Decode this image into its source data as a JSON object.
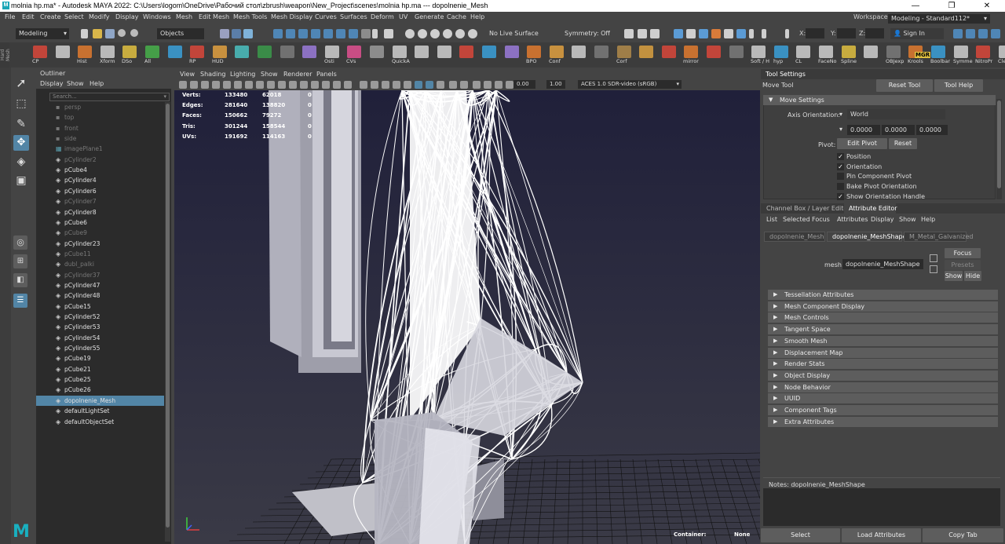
{
  "window": {
    "title": "molnia hp.ma* - Autodesk MAYA 2022: C:\\Users\\logom\\OneDrive\\Рабочий стол\\zbrush\\weapon\\New_Project\\scenes\\molnia hp.ma  ---  dopolnenie_Mesh",
    "app_icon_letter": "M",
    "controls": [
      "—",
      "❐",
      "✕"
    ]
  },
  "menubar": {
    "items": [
      "File",
      "Edit",
      "Create",
      "Select",
      "Modify",
      "Display",
      "Windows",
      "Mesh",
      "Edit Mesh",
      "Mesh Tools",
      "Mesh Display",
      "Curves",
      "Surfaces",
      "Deform",
      "UV",
      "Generate",
      "Cache",
      "Help"
    ],
    "workspace_label": "Workspace :",
    "workspace_value": "Modeling - Standard112*"
  },
  "statusline": {
    "menuset": "Modeling",
    "select_mode": "Objects",
    "live_surface": "No Live Surface",
    "symmetry": "Symmetry: Off",
    "x_label": "X:",
    "y_label": "Y:",
    "z_label": "Z:",
    "signin": "Sign In"
  },
  "shelf": {
    "side_label": "Hard Mesh",
    "items": [
      "CP",
      "",
      "Hist",
      "Xform",
      "DSo",
      "All",
      "",
      "RP",
      "HUD",
      "",
      "",
      "",
      "",
      "Osti",
      "CVs",
      "",
      "QuickA",
      "",
      "",
      "",
      "",
      "",
      "BPO",
      "Conf",
      "",
      "",
      "Corf",
      "",
      "",
      "mirror",
      "",
      "",
      "Soft / H",
      "hyp",
      "CL",
      "FaceNo",
      "Spline",
      "",
      "OBJexp",
      "Krools",
      "Boolbar",
      "Symme",
      "NitroPr",
      "CleanU"
    ],
    "badge": "MGR"
  },
  "outliner": {
    "title": "Outliner",
    "menu": [
      "Display",
      "Show",
      "Help"
    ],
    "search_placeholder": "Search...",
    "items": [
      {
        "name": "persp",
        "dim": true,
        "kind": "cam"
      },
      {
        "name": "top",
        "dim": true,
        "kind": "cam"
      },
      {
        "name": "front",
        "dim": true,
        "kind": "cam"
      },
      {
        "name": "side",
        "dim": true,
        "kind": "cam"
      },
      {
        "name": "imagePlane1",
        "dim": true,
        "kind": "img"
      },
      {
        "name": "pCylinder2",
        "dim": true,
        "kind": "mesh"
      },
      {
        "name": "pCube4",
        "dim": false,
        "kind": "mesh"
      },
      {
        "name": "pCylinder4",
        "dim": false,
        "kind": "mesh"
      },
      {
        "name": "pCylinder6",
        "dim": false,
        "kind": "mesh"
      },
      {
        "name": "pCylinder7",
        "dim": true,
        "kind": "mesh"
      },
      {
        "name": "pCylinder8",
        "dim": false,
        "kind": "mesh"
      },
      {
        "name": "pCube6",
        "dim": false,
        "kind": "mesh"
      },
      {
        "name": "pCube9",
        "dim": true,
        "kind": "mesh"
      },
      {
        "name": "pCylinder23",
        "dim": false,
        "kind": "mesh"
      },
      {
        "name": "pCube11",
        "dim": true,
        "kind": "mesh"
      },
      {
        "name": "dubl_palki",
        "dim": true,
        "kind": "mesh"
      },
      {
        "name": "pCylinder37",
        "dim": true,
        "kind": "mesh"
      },
      {
        "name": "pCylinder47",
        "dim": false,
        "kind": "mesh"
      },
      {
        "name": "pCylinder48",
        "dim": false,
        "kind": "mesh"
      },
      {
        "name": "pCube15",
        "dim": false,
        "kind": "mesh"
      },
      {
        "name": "pCylinder52",
        "dim": false,
        "kind": "mesh"
      },
      {
        "name": "pCylinder53",
        "dim": false,
        "kind": "mesh"
      },
      {
        "name": "pCylinder54",
        "dim": false,
        "kind": "mesh"
      },
      {
        "name": "pCylinder55",
        "dim": false,
        "kind": "mesh"
      },
      {
        "name": "pCube19",
        "dim": false,
        "kind": "mesh"
      },
      {
        "name": "pCube21",
        "dim": false,
        "kind": "mesh"
      },
      {
        "name": "pCube25",
        "dim": false,
        "kind": "mesh"
      },
      {
        "name": "pCube26",
        "dim": false,
        "kind": "mesh"
      },
      {
        "name": "dopolnenie_Mesh",
        "dim": false,
        "kind": "mesh",
        "selected": true
      },
      {
        "name": "defaultLightSet",
        "dim": false,
        "kind": "set"
      },
      {
        "name": "defaultObjectSet",
        "dim": false,
        "kind": "set"
      }
    ]
  },
  "viewport": {
    "menu": [
      "View",
      "Shading",
      "Lighting",
      "Show",
      "Renderer",
      "Panels"
    ],
    "field_near": "0.00",
    "field_far": "1.00",
    "color_space": "ACES 1.0 SDR-video (sRGB)",
    "hud": [
      {
        "label": "Verts:",
        "a": "133480",
        "b": "62018",
        "c": "0"
      },
      {
        "label": "Edges:",
        "a": "281640",
        "b": "138820",
        "c": "0"
      },
      {
        "label": "Faces:",
        "a": "150662",
        "b": "79272",
        "c": "0"
      },
      {
        "label": "Tris:",
        "a": "301244",
        "b": "158544",
        "c": "0"
      },
      {
        "label": "UVs:",
        "a": "191692",
        "b": "114163",
        "c": "0"
      }
    ],
    "container_label": "Container:",
    "container_value": "None"
  },
  "tool_settings": {
    "tab": "Tool Settings",
    "tool_name": "Move Tool",
    "reset_button": "Reset Tool",
    "help_button": "Tool Help",
    "section": "Move Settings",
    "axis_orientation_label": "Axis Orientation:",
    "axis_orientation_value": "World",
    "xyz": [
      "0.0000",
      "0.0000",
      "0.0000"
    ],
    "pivot_label": "Pivot:",
    "edit_pivot": "Edit Pivot",
    "reset": "Reset",
    "options": [
      {
        "label": "Position",
        "checked": true
      },
      {
        "label": "Orientation",
        "checked": true
      },
      {
        "label": "Pin Component Pivot",
        "checked": false
      },
      {
        "label": "Bake Pivot Orientation",
        "checked": false
      },
      {
        "label": "Show Orientation Handle",
        "checked": true
      }
    ]
  },
  "attribute_editor": {
    "tabs": [
      "Channel Box / Layer Editor",
      "Attribute Editor"
    ],
    "menu": [
      "List",
      "Selected",
      "Focus",
      "Attributes",
      "Display",
      "Show",
      "Help"
    ],
    "node_tabs": [
      "dopolnenie_Mesh",
      "dopolnenie_MeshShape",
      "M_Metal_Galvanized"
    ],
    "mesh_label": "mesh:",
    "mesh_value": "dopolnenie_MeshShape",
    "focus": "Focus",
    "presets": "Presets",
    "show": "Show",
    "hide": "Hide",
    "sections": [
      "Tessellation Attributes",
      "Mesh Component Display",
      "Mesh Controls",
      "Tangent Space",
      "Smooth Mesh",
      "Displacement Map",
      "Render Stats",
      "Object Display",
      "Node Behavior",
      "UUID",
      "Component Tags",
      "Extra Attributes"
    ],
    "notes_label": "Notes:  dopolnenie_MeshShape",
    "bottom_buttons": [
      "Select",
      "Load Attributes",
      "Copy Tab"
    ]
  },
  "colors": {
    "accent": "#5285a6",
    "maya_teal": "#19b0c0",
    "viewport_bg_top": "#20203a",
    "viewport_bg_bottom": "#3a3a46"
  }
}
